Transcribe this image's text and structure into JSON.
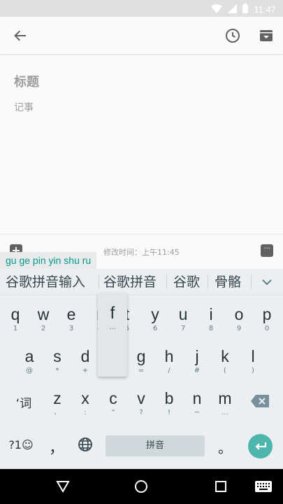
{
  "status_bar": {
    "time": "11:47"
  },
  "note": {
    "title_placeholder": "标题",
    "body_placeholder": "记事"
  },
  "bottom_bar": {
    "edited": "修改时间：上午11:45"
  },
  "ime": {
    "composing": "gu ge pin yin shu ru",
    "candidates": [
      "谷歌拼音输入",
      "谷歌拼音",
      "谷歌",
      "骨骼"
    ],
    "popup": {
      "main": "f",
      "hint": "…"
    },
    "row1": [
      {
        "main": "q",
        "hint": "1"
      },
      {
        "main": "w",
        "hint": "2"
      },
      {
        "main": "e",
        "hint": "3"
      },
      {
        "main": "r",
        "hint": "4"
      },
      {
        "main": "t",
        "hint": "5"
      },
      {
        "main": "y",
        "hint": "6"
      },
      {
        "main": "u",
        "hint": "7"
      },
      {
        "main": "i",
        "hint": "8"
      },
      {
        "main": "o",
        "hint": "9"
      },
      {
        "main": "p",
        "hint": "0"
      }
    ],
    "row2": [
      {
        "main": "a",
        "hint": "@"
      },
      {
        "main": "s",
        "hint": "*"
      },
      {
        "main": "d",
        "hint": "+"
      },
      {
        "main": "f",
        "hint": "-"
      },
      {
        "main": "g",
        "hint": "="
      },
      {
        "main": "h",
        "hint": "/"
      },
      {
        "main": "j",
        "hint": "#"
      },
      {
        "main": "k",
        "hint": "("
      },
      {
        "main": "l",
        "hint": ")"
      }
    ],
    "row3_left": "‘词",
    "row3": [
      {
        "main": "z",
        "hint": "、"
      },
      {
        "main": "x",
        "hint": ":"
      },
      {
        "main": "c",
        "hint": "\""
      },
      {
        "main": "v",
        "hint": "?"
      },
      {
        "main": "b",
        "hint": "!"
      },
      {
        "main": "n",
        "hint": "~"
      },
      {
        "main": "m",
        "hint": "…"
      }
    ],
    "symbols_label": "?1☺",
    "comma": "，",
    "space_label": "拼音",
    "period": "。"
  }
}
